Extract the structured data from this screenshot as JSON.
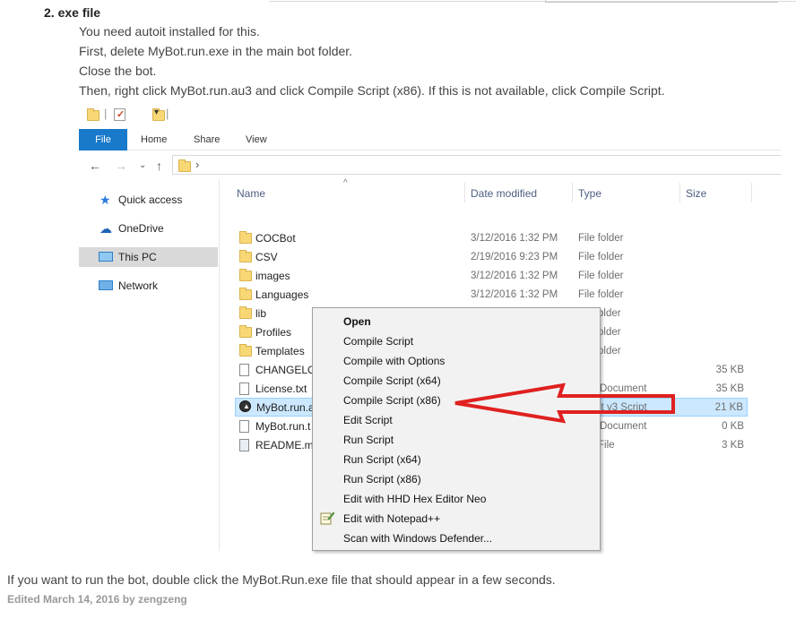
{
  "post": {
    "heading": "2. exe file",
    "lines": [
      "You need autoit installed for this.",
      "First, delete MyBot.run.exe in the main bot folder.",
      "Close the bot.",
      "Then, right click MyBot.run.au3 and click Compile Script (x86). If this is not available, click Compile Script."
    ],
    "footer": "If you want to run the bot, double click the MyBot.Run.exe file that should appear in a few seconds.",
    "edited": "Edited March 14, 2016 by zengzeng"
  },
  "explorer": {
    "ribbon_tabs": [
      "File",
      "Home",
      "Share",
      "View"
    ],
    "nav": {
      "back": "←",
      "forward": "→",
      "recent": "⌄",
      "up": "↑",
      "chevron": "›"
    },
    "sidebar": [
      {
        "label": "Quick access",
        "icon": "star-icon"
      },
      {
        "label": "OneDrive",
        "icon": "cloud-icon"
      },
      {
        "label": "This PC",
        "icon": "monitor-icon"
      },
      {
        "label": "Network",
        "icon": "network-icon"
      }
    ],
    "columns": [
      "Name",
      "Date modified",
      "Type",
      "Size"
    ],
    "files": [
      {
        "name": "COCBot",
        "date": "3/12/2016 1:32 PM",
        "type": "File folder",
        "size": "",
        "icon": "folder-icon"
      },
      {
        "name": "CSV",
        "date": "2/19/2016 9:23 PM",
        "type": "File folder",
        "size": "",
        "icon": "folder-icon"
      },
      {
        "name": "images",
        "date": "3/12/2016 1:32 PM",
        "type": "File folder",
        "size": "",
        "icon": "folder-icon"
      },
      {
        "name": "Languages",
        "date": "3/12/2016 1:32 PM",
        "type": "File folder",
        "size": "",
        "icon": "folder-icon"
      },
      {
        "name": "lib",
        "date": "",
        "type": "older",
        "size": "",
        "icon": "folder-icon"
      },
      {
        "name": "Profiles",
        "date": "",
        "type": "older",
        "size": "",
        "icon": "folder-icon"
      },
      {
        "name": "Templates",
        "date": "",
        "type": "older",
        "size": "",
        "icon": "folder-icon"
      },
      {
        "name": "CHANGELO",
        "date": "",
        "type": "",
        "size": "35 KB",
        "icon": "document-icon"
      },
      {
        "name": "License.txt",
        "date": "",
        "type": "Document",
        "size": "35 KB",
        "icon": "document-icon"
      },
      {
        "name": "MyBot.run.a",
        "date": "",
        "type": "lt v3 Script",
        "size": "21 KB",
        "icon": "autoit-icon"
      },
      {
        "name": "MyBot.run.t",
        "date": "",
        "type": "Document",
        "size": "0 KB",
        "icon": "document-icon"
      },
      {
        "name": "README.mc",
        "date": "",
        "type": "File",
        "size": "3 KB",
        "icon": "document-icon"
      }
    ]
  },
  "context_menu": [
    "Open",
    "Compile Script",
    "Compile with Options",
    "Compile Script (x64)",
    "Compile Script (x86)",
    "Edit Script",
    "Run Script",
    "Run Script (x64)",
    "Run Script (x86)",
    "Edit with HHD Hex Editor Neo",
    "Edit with Notepad++",
    "Scan with Windows Defender..."
  ],
  "colors": {
    "file_tab": "#1979ca",
    "selection": "#cce8ff",
    "arrow": "#e02020",
    "folder": "#f8d775"
  }
}
